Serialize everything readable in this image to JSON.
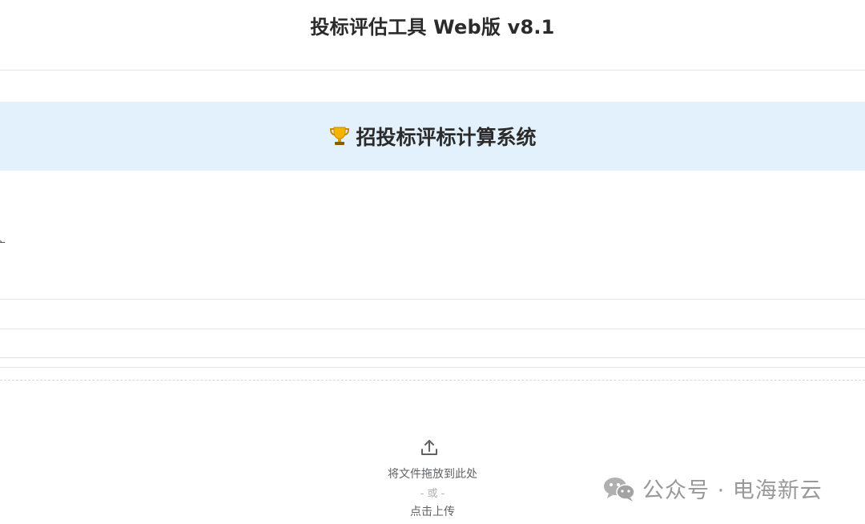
{
  "header": {
    "title": "投标评估工具 Web版 v8.1"
  },
  "hero": {
    "icon": "trophy-icon",
    "title": "招投标评标计算系统"
  },
  "side_stub": {
    "text": "广"
  },
  "upload": {
    "icon": "upload-icon",
    "drag_text": "将文件拖放到此处",
    "or_text": "- 或 -",
    "click_text": "点击上传"
  },
  "watermark": {
    "icon": "wechat-icon",
    "text": "公众号 · 电海新云"
  },
  "colors": {
    "hero_background": "#e3f1fc",
    "trophy_gold": "#f4b400",
    "text_dark": "#2b2b2b",
    "muted": "#606266"
  }
}
